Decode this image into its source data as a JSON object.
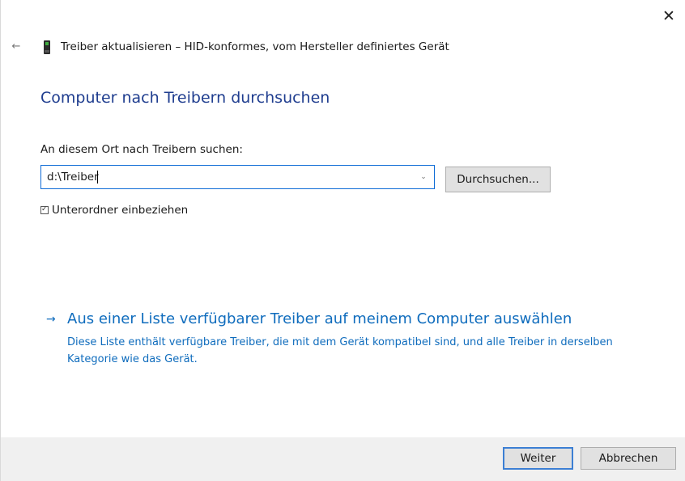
{
  "window": {
    "title": "Treiber aktualisieren – HID-konformes, vom Hersteller definiertes Gerät",
    "close_icon": "close-icon",
    "back_icon": "back-arrow-icon",
    "device_icon": "device-icon"
  },
  "main": {
    "heading": "Computer nach Treibern durchsuchen",
    "search_label": "An diesem Ort nach Treibern suchen:",
    "path_value": "d:\\Treiber",
    "browse_label": "Durchsuchen...",
    "include_subfolders": {
      "label": "Unterordner einbeziehen",
      "checked": true
    },
    "list_option": {
      "title": "Aus einer Liste verfügbarer Treiber auf meinem Computer auswählen",
      "description": "Diese Liste enthält verfügbare Treiber, die mit dem Gerät kompatibel sind, und alle Treiber in derselben Kategorie wie das Gerät."
    }
  },
  "footer": {
    "next_label": "Weiter",
    "cancel_label": "Abbrechen"
  },
  "colors": {
    "heading": "#1f3d8f",
    "link": "#0f6cbd",
    "footer_bg": "#f0f0f0",
    "focus_border": "#3c7fd4"
  }
}
